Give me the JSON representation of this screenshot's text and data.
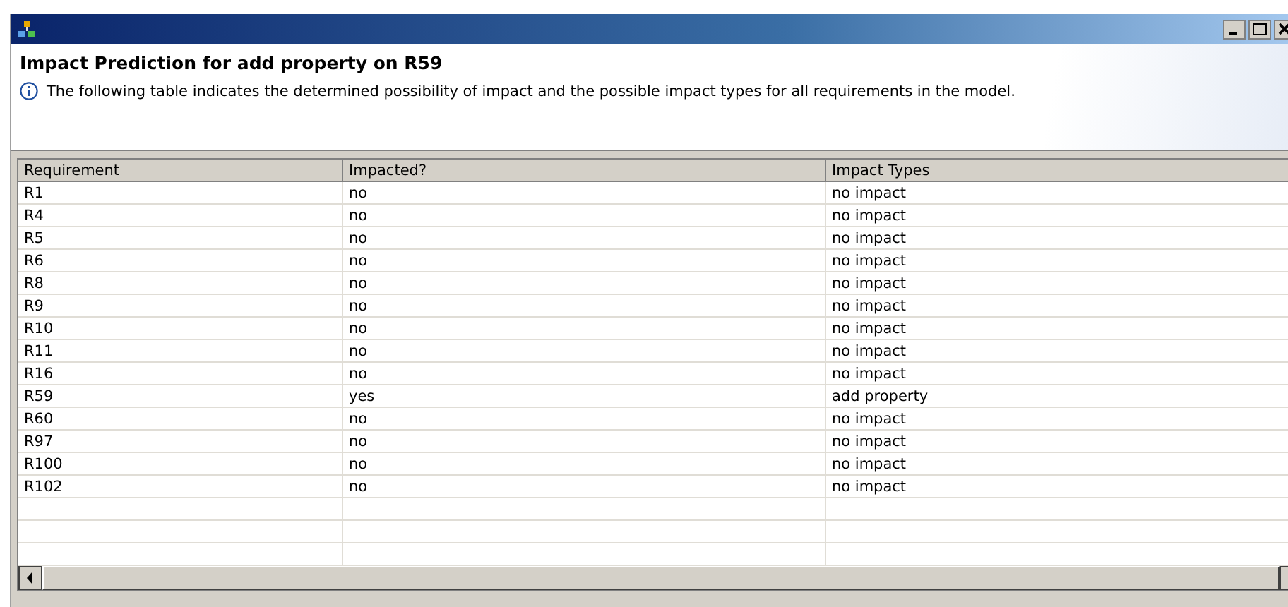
{
  "dialog": {
    "heading": "Impact Prediction for add property on R59",
    "message": "The following table indicates the determined possibility of impact and the possible impact types for all requirements in the model."
  },
  "table": {
    "columns": [
      "Requirement",
      "Impacted?",
      "Impact Types"
    ],
    "rows": [
      [
        "R1",
        "no",
        "no impact"
      ],
      [
        "R4",
        "no",
        "no impact"
      ],
      [
        "R5",
        "no",
        "no impact"
      ],
      [
        "R6",
        "no",
        "no impact"
      ],
      [
        "R8",
        "no",
        "no impact"
      ],
      [
        "R9",
        "no",
        "no impact"
      ],
      [
        "R10",
        "no",
        "no impact"
      ],
      [
        "R11",
        "no",
        "no impact"
      ],
      [
        "R16",
        "no",
        "no impact"
      ],
      [
        "R59",
        "yes",
        "add property"
      ],
      [
        "R60",
        "no",
        "no impact"
      ],
      [
        "R97",
        "no",
        "no impact"
      ],
      [
        "R100",
        "no",
        "no impact"
      ],
      [
        "R102",
        "no",
        "no impact"
      ]
    ]
  }
}
